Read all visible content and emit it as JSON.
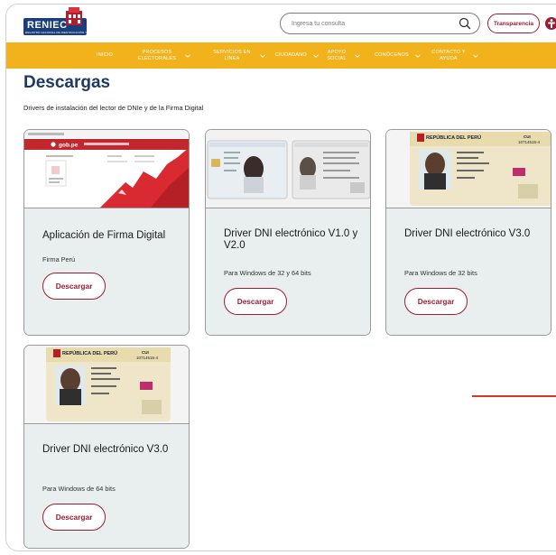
{
  "header": {
    "logo_text": "RENIEC",
    "logo_subtext": "REGISTRO NACIONAL DE IDENTIFICACIÓN Y ESTADO CIVIL",
    "search": {
      "placeholder": "Ingresa tu consulta"
    },
    "transparency_label": "Transparencia"
  },
  "nav": {
    "items": [
      {
        "label": "INICIO",
        "has_dropdown": false
      },
      {
        "label": "PROCESOS ELECTORALES",
        "has_dropdown": true
      },
      {
        "label": "SERVICIOS EN LÍNEA",
        "has_dropdown": true
      },
      {
        "label": "CIUDADANO",
        "has_dropdown": true
      },
      {
        "label": "APOYO SOCIAL",
        "has_dropdown": true
      },
      {
        "label": "CONÓCENOS",
        "has_dropdown": true
      },
      {
        "label": "CONTACTO Y AYUDA",
        "has_dropdown": true
      }
    ]
  },
  "page": {
    "title": "Descargas",
    "subtitle": "Drivers de instalación del lector de DNIe y de la Firma Digital"
  },
  "cards": [
    {
      "title": "Aplicación de Firma Digital",
      "description": "Firma Perú",
      "button": "Descargar",
      "image": "firma-digital-screenshot"
    },
    {
      "title": "Driver DNI electrónico V1.0 y V2.0",
      "description": "Para Windows de 32 y 64 bits",
      "button": "Descargar",
      "image": "dni-cards"
    },
    {
      "title": "Driver DNI electrónico V3.0",
      "description": "Para Windows de 32 bits",
      "button": "Descargar",
      "image": "dni-card-v3"
    },
    {
      "title": "Driver DNI electrónico V3.0",
      "description": "Para Windows de 64 bits",
      "button": "Descargar",
      "image": "dni-card-v3"
    }
  ],
  "screenshot_texts": {
    "gob": "gob.pe"
  },
  "dni_texts": {
    "country": "REPÚBLICA DEL PERÚ",
    "doc": "CUI",
    "number": "10714515-4"
  },
  "colors": {
    "nav_bg": "#f2b21b",
    "accent": "#9b1b32",
    "title_blue": "#1f3a62",
    "card_body": "#e9eeef"
  }
}
